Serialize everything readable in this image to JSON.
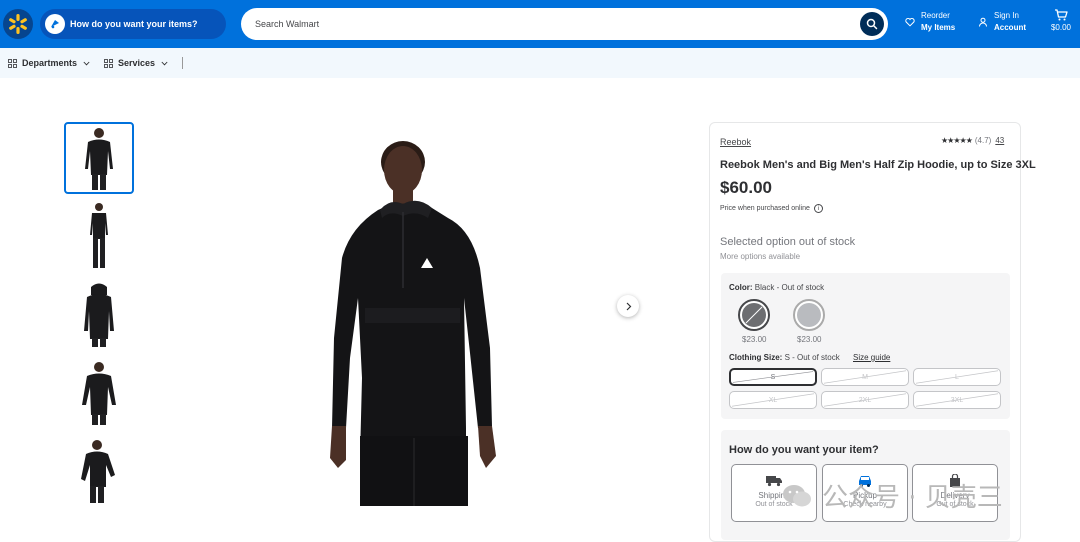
{
  "header": {
    "delivery_prompt": "How do you want your items?",
    "search_placeholder": "Search Walmart",
    "reorder_top": "Reorder",
    "reorder_bottom": "My Items",
    "account_top": "Sign In",
    "account_bottom": "Account",
    "cart_total": "$0.00",
    "brand_color": "#0071dc"
  },
  "subnav": {
    "departments": "Departments",
    "services": "Services"
  },
  "gallery": {
    "thumbnail_count": 5,
    "active_index": 0
  },
  "product": {
    "brand": "Reebok",
    "stars": "★★★★★",
    "rating": "(4.7)",
    "review_count": "43",
    "title": "Reebok Men's and Big Men's Half Zip Hoodie, up to Size 3XL",
    "price": "$60.00",
    "price_note": "Price when purchased online",
    "selected_status": "Selected option out of stock",
    "more_options": "More options available"
  },
  "variants": {
    "color_label": "Color:",
    "color_value": "Black - Out of stock",
    "swatches": [
      {
        "price": "$23.00",
        "color": "#6d6e71"
      },
      {
        "price": "$23.00",
        "color": "#b9bbbf"
      }
    ],
    "size_label": "Clothing Size:",
    "size_value": "S - Out of stock",
    "size_guide": "Size guide",
    "sizes": [
      "S",
      "M",
      "L",
      "XL",
      "2XL",
      "3XL"
    ]
  },
  "fulfillment": {
    "title": "How do you want your item?",
    "options": [
      {
        "name": "Shipping",
        "status": "Out of stock"
      },
      {
        "name": "Pickup",
        "status": "Check nearby"
      },
      {
        "name": "Delivery",
        "status": "Out of stock"
      }
    ]
  },
  "watermark": {
    "text": "公众号 · 贝壳三"
  }
}
